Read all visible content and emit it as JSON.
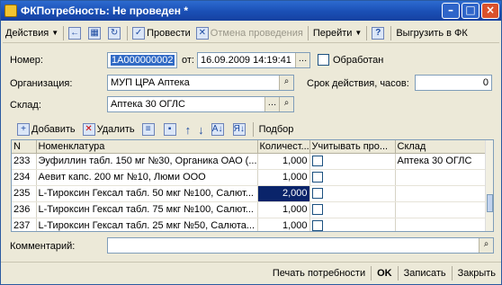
{
  "window": {
    "title": "ФКПотребность: Не проведен *"
  },
  "toolbar": {
    "actions_label": "Действия",
    "post_label": "Провести",
    "unpost_label": "Отмена проведения",
    "goto_label": "Перейти",
    "help_label": "?",
    "export_label": "Выгрузить в ФК"
  },
  "form": {
    "number_label": "Номер:",
    "number_value": "1А000000002",
    "from_label": "от:",
    "date_value": "16.09.2009 14:19:41",
    "processed_label": "Обработан",
    "org_label": "Организация:",
    "org_value": "МУП ЦРА Аптека",
    "validity_label": "Срок действия, часов:",
    "validity_value": "0",
    "warehouse_label": "Склад:",
    "warehouse_value": "Аптека 30 ОГЛС"
  },
  "tab_toolbar": {
    "add_label": "Добавить",
    "delete_label": "Удалить",
    "select_label": "Подбор"
  },
  "table": {
    "columns": [
      "N",
      "Номенклатура",
      "Количест...",
      "Учитывать про...",
      "Склад"
    ],
    "rows": [
      {
        "n": "233",
        "name": "Эуфиллин табл. 150 мг №30, Органика ОАО (...",
        "qty": "1,000",
        "warehouse": "Аптека 30 ОГЛС"
      },
      {
        "n": "234",
        "name": "Аевит капс. 200 мг №10, Люми ООО",
        "qty": "1,000",
        "warehouse": ""
      },
      {
        "n": "235",
        "name": "L-Тироксин Гексал табл. 50 мкг №100, Салют...",
        "qty": "2,000",
        "warehouse": ""
      },
      {
        "n": "236",
        "name": "L-Тироксин Гексал табл. 75 мкг №100, Салют...",
        "qty": "1,000",
        "warehouse": ""
      },
      {
        "n": "237",
        "name": "L-Тироксин Гексал табл. 25 мкг №50, Салюта...",
        "qty": "1,000",
        "warehouse": ""
      }
    ]
  },
  "comment": {
    "label": "Комментарий:",
    "value": ""
  },
  "bottom": {
    "print_label": "Печать потребности",
    "ok_label": "OK",
    "save_label": "Записать",
    "close_label": "Закрыть"
  }
}
